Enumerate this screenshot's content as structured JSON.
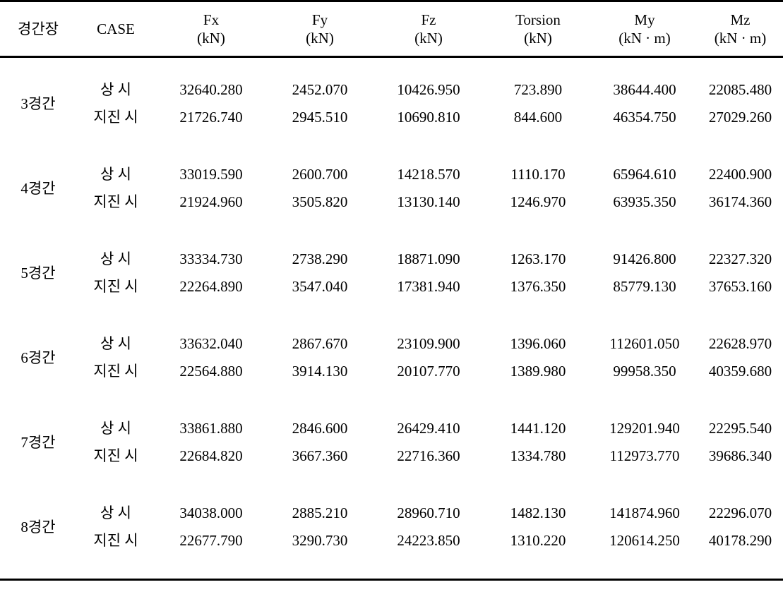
{
  "table": {
    "columns": [
      {
        "id": "span",
        "label": "경간장",
        "unit": ""
      },
      {
        "id": "case",
        "label": "CASE",
        "unit": ""
      },
      {
        "id": "fx",
        "label": "Fx",
        "unit": "(kN)"
      },
      {
        "id": "fy",
        "label": "Fy",
        "unit": "(kN)"
      },
      {
        "id": "fz",
        "label": "Fz",
        "unit": "(kN)"
      },
      {
        "id": "torsion",
        "label": "Torsion",
        "unit": "(kN)"
      },
      {
        "id": "my",
        "label": "My",
        "unit": "(kN · m)"
      },
      {
        "id": "mz",
        "label": "Mz",
        "unit": "(kN · m)"
      }
    ],
    "case_labels": {
      "normal": "상  시",
      "seismic": "지진 시"
    },
    "groups": [
      {
        "span": "3경간",
        "rows": [
          {
            "case": "상  시",
            "fx": "32640.280",
            "fy": "2452.070",
            "fz": "10426.950",
            "torsion": "723.890",
            "my": "38644.400",
            "mz": "22085.480"
          },
          {
            "case": "지진 시",
            "fx": "21726.740",
            "fy": "2945.510",
            "fz": "10690.810",
            "torsion": "844.600",
            "my": "46354.750",
            "mz": "27029.260"
          }
        ]
      },
      {
        "span": "4경간",
        "rows": [
          {
            "case": "상  시",
            "fx": "33019.590",
            "fy": "2600.700",
            "fz": "14218.570",
            "torsion": "1110.170",
            "my": "65964.610",
            "mz": "22400.900"
          },
          {
            "case": "지진 시",
            "fx": "21924.960",
            "fy": "3505.820",
            "fz": "13130.140",
            "torsion": "1246.970",
            "my": "63935.350",
            "mz": "36174.360"
          }
        ]
      },
      {
        "span": "5경간",
        "rows": [
          {
            "case": "상  시",
            "fx": "33334.730",
            "fy": "2738.290",
            "fz": "18871.090",
            "torsion": "1263.170",
            "my": "91426.800",
            "mz": "22327.320"
          },
          {
            "case": "지진 시",
            "fx": "22264.890",
            "fy": "3547.040",
            "fz": "17381.940",
            "torsion": "1376.350",
            "my": "85779.130",
            "mz": "37653.160"
          }
        ]
      },
      {
        "span": "6경간",
        "rows": [
          {
            "case": "상  시",
            "fx": "33632.040",
            "fy": "2867.670",
            "fz": "23109.900",
            "torsion": "1396.060",
            "my": "112601.050",
            "mz": "22628.970"
          },
          {
            "case": "지진 시",
            "fx": "22564.880",
            "fy": "3914.130",
            "fz": "20107.770",
            "torsion": "1389.980",
            "my": "99958.350",
            "mz": "40359.680"
          }
        ]
      },
      {
        "span": "7경간",
        "rows": [
          {
            "case": "상  시",
            "fx": "33861.880",
            "fy": "2846.600",
            "fz": "26429.410",
            "torsion": "1441.120",
            "my": "129201.940",
            "mz": "22295.540"
          },
          {
            "case": "지진 시",
            "fx": "22684.820",
            "fy": "3667.360",
            "fz": "22716.360",
            "torsion": "1334.780",
            "my": "112973.770",
            "mz": "39686.340"
          }
        ]
      },
      {
        "span": "8경간",
        "rows": [
          {
            "case": "상  시",
            "fx": "34038.000",
            "fy": "2885.210",
            "fz": "28960.710",
            "torsion": "1482.130",
            "my": "141874.960",
            "mz": "22296.070"
          },
          {
            "case": "지진 시",
            "fx": "22677.790",
            "fy": "3290.730",
            "fz": "24223.850",
            "torsion": "1310.220",
            "my": "120614.250",
            "mz": "40178.290"
          }
        ]
      }
    ]
  }
}
